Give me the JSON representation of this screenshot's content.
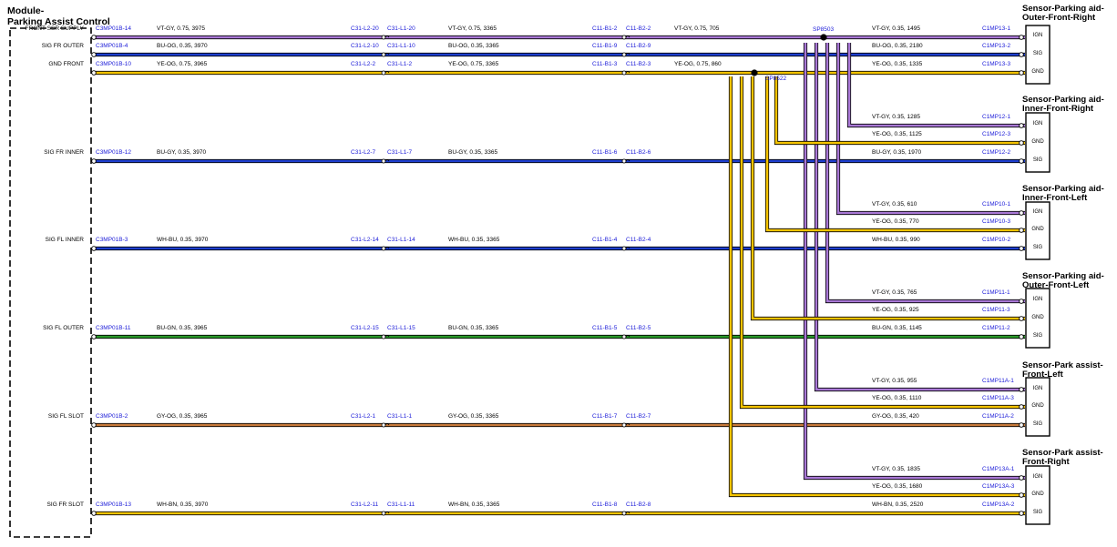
{
  "colors": {
    "violet": "#a978d6",
    "yellow": "#f5c400",
    "blue": "#1e3fd0",
    "green": "#2a9a2a",
    "brown": "#c87a3a",
    "black": "#000000",
    "connector_text": "#1a1ad8"
  },
  "module": {
    "title_line1": "Module-",
    "title_line2": "Parking Assist Control"
  },
  "signals": [
    {
      "label": "FRONT SSR SUPPLY",
      "c1": "C3MP01B-14",
      "w1": "VT-GY,  0.75,  3975",
      "c2": "C31-L2-20",
      "c3": "C31-L1-20",
      "w2": "VT-GY,  0.75,  3365",
      "c4": "C11-B1-2",
      "c5": "C11-B2-2",
      "w3": "VT-GY,  0.75,  705"
    },
    {
      "label": "SIG FR OUTER",
      "c1": "C3MP01B-4",
      "w1": "BU-OG,  0.35,  3970",
      "c2": "C31-L2-10",
      "c3": "C31-L1-10",
      "w2": "BU-OG,  0.35,  3365",
      "c4": "C11-B1-9",
      "c5": "C11-B2-9",
      "w3": ""
    },
    {
      "label": "GND FRONT",
      "c1": "C3MP01B-10",
      "w1": "YE-OG,  0.75,  3965",
      "c2": "C31-L2-2",
      "c3": "C31-L1-2",
      "w2": "YE-OG,  0.75,  3365",
      "c4": "C11-B1-3",
      "c5": "C11-B2-3",
      "w3": "YE-OG,  0.75,  860"
    },
    {
      "label": "SIG FR INNER",
      "c1": "C3MP01B-12",
      "w1": "BU-GY,  0.35,  3970",
      "c2": "C31-L2-7",
      "c3": "C31-L1-7",
      "w2": "BU-GY,  0.35,  3365",
      "c4": "C11-B1-6",
      "c5": "C11-B2-6",
      "w3": ""
    },
    {
      "label": "SIG FL INNER",
      "c1": "C3MP01B-3",
      "w1": "WH-BU,  0.35,  3970",
      "c2": "C31-L2-14",
      "c3": "C31-L1-14",
      "w2": "WH-BU,  0.35,  3365",
      "c4": "C11-B1-4",
      "c5": "C11-B2-4",
      "w3": ""
    },
    {
      "label": "SIG FL OUTER",
      "c1": "C3MP01B-11",
      "w1": "BU-GN,  0.35,  3965",
      "c2": "C31-L2-15",
      "c3": "C31-L1-15",
      "w2": "BU-GN,  0.35,  3365",
      "c4": "C11-B1-5",
      "c5": "C11-B2-5",
      "w3": ""
    },
    {
      "label": "SIG FL SLOT",
      "c1": "C3MP01B-2",
      "w1": "GY-OG,  0.35,  3965",
      "c2": "C31-L2-1",
      "c3": "C31-L1-1",
      "w2": "GY-OG,  0.35,  3365",
      "c4": "C11-B1-7",
      "c5": "C11-B2-7",
      "w3": ""
    },
    {
      "label": "SIG FR SLOT",
      "c1": "C3MP01B-13",
      "w1": "WH-BN,  0.35,  3970",
      "c2": "C31-L2-11",
      "c3": "C31-L1-11",
      "w2": "WH-BN,  0.35,  3365",
      "c4": "C11-B1-8",
      "c5": "C11-B2-8",
      "w3": ""
    }
  ],
  "splices": {
    "sp1": "SP8503",
    "sp2": "SP8522"
  },
  "sensors": [
    {
      "title1": "Sensor-Parking aid-",
      "title2": "Outer-Front-Right",
      "pins": [
        "IGN",
        "SIG",
        "GND"
      ],
      "wires": [
        {
          "text": "VT-GY,  0.35,  1495",
          "conn": "C1MP13-1"
        },
        {
          "text": "BU-OG,  0.35,  2180",
          "conn": "C1MP13-2"
        },
        {
          "text": "YE-OG,  0.35,  1335",
          "conn": "C1MP13-3"
        }
      ]
    },
    {
      "title1": "Sensor-Parking aid-",
      "title2": "Inner-Front-Right",
      "pins": [
        "IGN",
        "GND",
        "SIG"
      ],
      "wires": [
        {
          "text": "VT-GY,  0.35,  1285",
          "conn": "C1MP12-1"
        },
        {
          "text": "YE-OG,  0.35,  1125",
          "conn": "C1MP12-3"
        },
        {
          "text": "BU-GY,  0.35,  1970",
          "conn": "C1MP12-2"
        }
      ]
    },
    {
      "title1": "Sensor-Parking aid-",
      "title2": "Inner-Front-Left",
      "pins": [
        "IGN",
        "GND",
        "SIG"
      ],
      "wires": [
        {
          "text": "VT-GY,  0.35,  610",
          "conn": "C1MP10-1"
        },
        {
          "text": "YE-OG,  0.35,  770",
          "conn": "C1MP10-3"
        },
        {
          "text": "WH-BU,  0.35,  990",
          "conn": "C1MP10-2"
        }
      ]
    },
    {
      "title1": "Sensor-Parking aid-",
      "title2": "Outer-Front-Left",
      "pins": [
        "IGN",
        "GND",
        "SIG"
      ],
      "wires": [
        {
          "text": "VT-GY,  0.35,  765",
          "conn": "C1MP11-1"
        },
        {
          "text": "YE-OG,  0.35,  925",
          "conn": "C1MP11-3"
        },
        {
          "text": "BU-GN,  0.35,  1145",
          "conn": "C1MP11-2"
        }
      ]
    },
    {
      "title1": "Sensor-Park assist-",
      "title2": "Front-Left",
      "pins": [
        "IGN",
        "GND",
        "SIG"
      ],
      "wires": [
        {
          "text": "VT-GY,  0.35,  955",
          "conn": "C1MP11A-1"
        },
        {
          "text": "YE-OG,  0.35,  1110",
          "conn": "C1MP11A-3"
        },
        {
          "text": "GY-OG,  0.35,  420",
          "conn": "C1MP11A-2"
        }
      ]
    },
    {
      "title1": "Sensor-Park assist-",
      "title2": "Front-Right",
      "pins": [
        "IGN",
        "GND",
        "SIG"
      ],
      "wires": [
        {
          "text": "VT-GY,  0.35,  1835",
          "conn": "C1MP13A-1"
        },
        {
          "text": "YE-OG,  0.35,  1680",
          "conn": "C1MP13A-3"
        },
        {
          "text": "WH-BN,  0.35,  2520",
          "conn": "C1MP13A-2"
        }
      ]
    }
  ]
}
